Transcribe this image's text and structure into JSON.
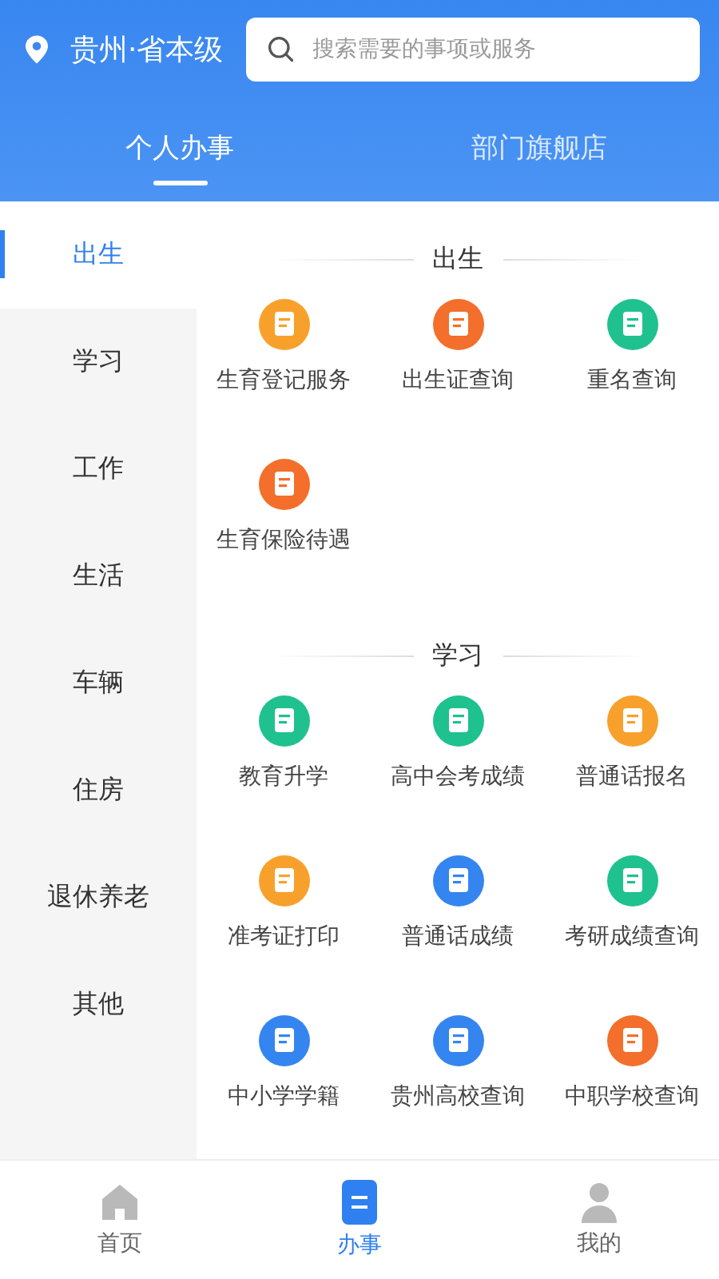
{
  "header": {
    "location": "贵州·省本级",
    "search": {
      "placeholder": "搜索需要的事项或服务"
    }
  },
  "tabs": [
    {
      "label": "个人办事",
      "selected": true
    },
    {
      "label": "部门旗舰店",
      "selected": false
    }
  ],
  "sidebar": {
    "items": [
      {
        "label": "出生",
        "selected": true
      },
      {
        "label": "学习",
        "selected": false
      },
      {
        "label": "工作",
        "selected": false
      },
      {
        "label": "生活",
        "selected": false
      },
      {
        "label": "车辆",
        "selected": false
      },
      {
        "label": "住房",
        "selected": false
      },
      {
        "label": "退休养老",
        "selected": false
      },
      {
        "label": "其他",
        "selected": false
      }
    ]
  },
  "sections": [
    {
      "title": "出生",
      "services": [
        {
          "label": "生育登记服务",
          "color": "#f7a12c"
        },
        {
          "label": "出生证查询",
          "color": "#f36f2b"
        },
        {
          "label": "重名查询",
          "color": "#1fc18f"
        },
        {
          "label": "生育保险待遇",
          "color": "#f36f2b"
        }
      ]
    },
    {
      "title": "学习",
      "services": [
        {
          "label": "教育升学",
          "color": "#1fc18f"
        },
        {
          "label": "高中会考成绩",
          "color": "#1fc18f"
        },
        {
          "label": "普通话报名",
          "color": "#f7a12c"
        },
        {
          "label": "准考证打印",
          "color": "#f7a12c"
        },
        {
          "label": "普通话成绩",
          "color": "#3585f0"
        },
        {
          "label": "考研成绩查询",
          "color": "#1fc18f"
        },
        {
          "label": "中小学学籍",
          "color": "#3585f0"
        },
        {
          "label": "贵州高校查询",
          "color": "#3585f0"
        },
        {
          "label": "中职学校查询",
          "color": "#f36f2b"
        }
      ]
    }
  ],
  "bottom_nav": [
    {
      "label": "首页",
      "selected": false
    },
    {
      "label": "办事",
      "selected": true
    },
    {
      "label": "我的",
      "selected": false
    }
  ]
}
